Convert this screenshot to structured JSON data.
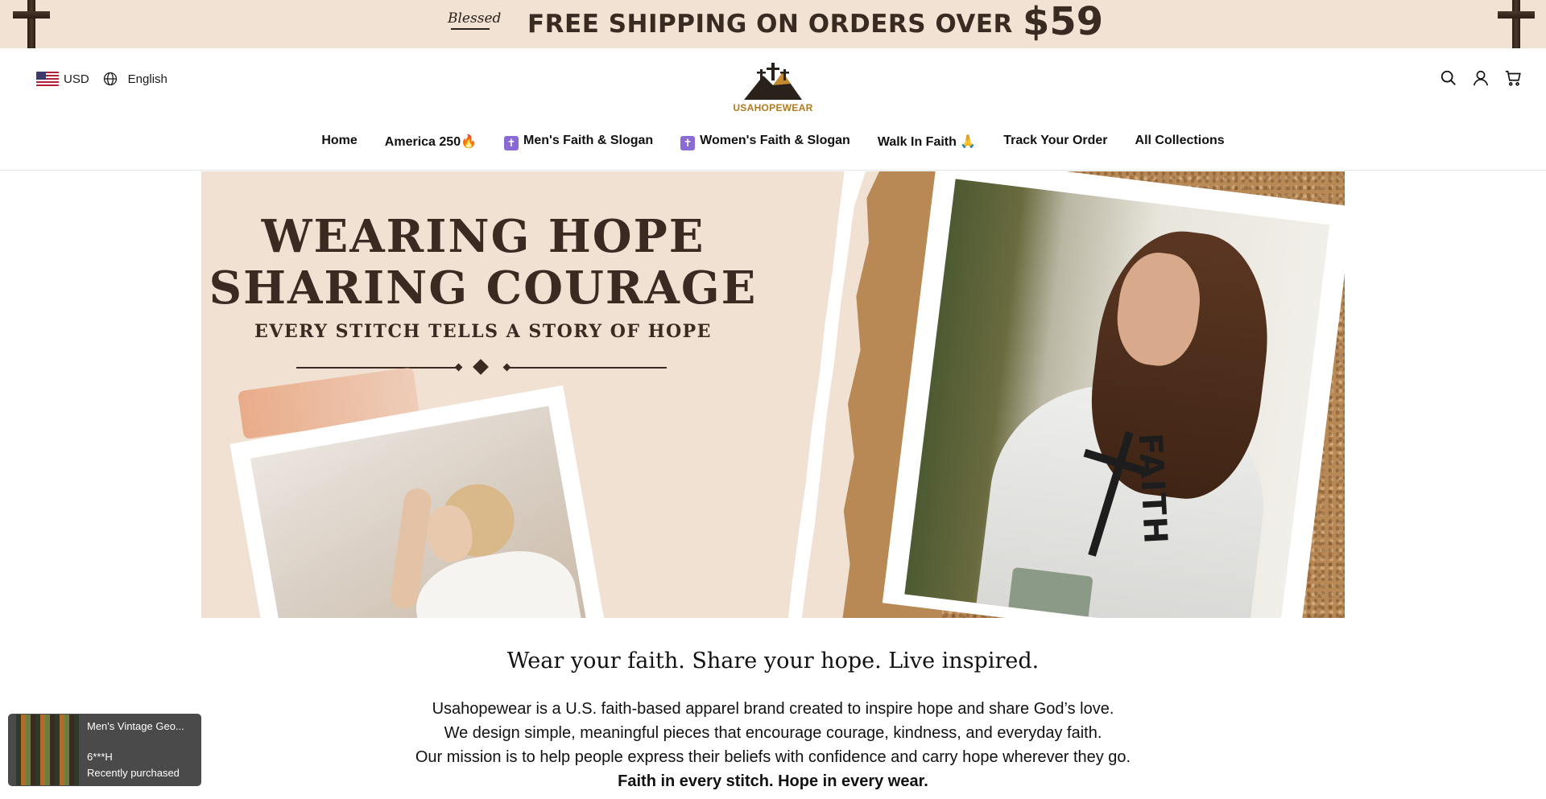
{
  "announcement": {
    "blessed": "Blessed",
    "text": "FREE SHIPPING ON ORDERS OVER",
    "amount": "$59"
  },
  "header": {
    "currency": "USD",
    "language": "English",
    "logo_text": "USAHOPEWEAR"
  },
  "nav": {
    "items": [
      {
        "label": "Home"
      },
      {
        "label": "America 250🔥"
      },
      {
        "label": "Men's Faith & Slogan",
        "badge": "✝"
      },
      {
        "label": "Women's Faith & Slogan",
        "badge": "✝"
      },
      {
        "label": "Walk In Faith 🙏"
      },
      {
        "label": "Track Your Order"
      },
      {
        "label": "All Collections"
      }
    ]
  },
  "hero": {
    "line1": "WEARING HOPE",
    "line2": "SHARING COURAGE",
    "sub": "EVERY STITCH TELLS A STORY OF HOPE",
    "shirt_text": "FAITH"
  },
  "content": {
    "tagline": "Wear your faith. Share your hope. Live inspired.",
    "p1": "Usahopewear is a U.S. faith-based apparel brand created to inspire hope and share God’s love.",
    "p2": "We design simple, meaningful pieces that encourage courage, kindness, and everyday faith.",
    "p3": "Our mission is to help people express their beliefs with confidence and carry hope wherever they go.",
    "p4": "Faith in every stitch. Hope in every wear."
  },
  "popup": {
    "title": "Men's Vintage Geo...",
    "buyer": "6***H",
    "status": "Recently purchased"
  },
  "icons": {
    "search": "search-icon",
    "account": "account-icon",
    "cart": "cart-icon",
    "globe": "globe-icon",
    "flag": "us-flag-icon"
  }
}
